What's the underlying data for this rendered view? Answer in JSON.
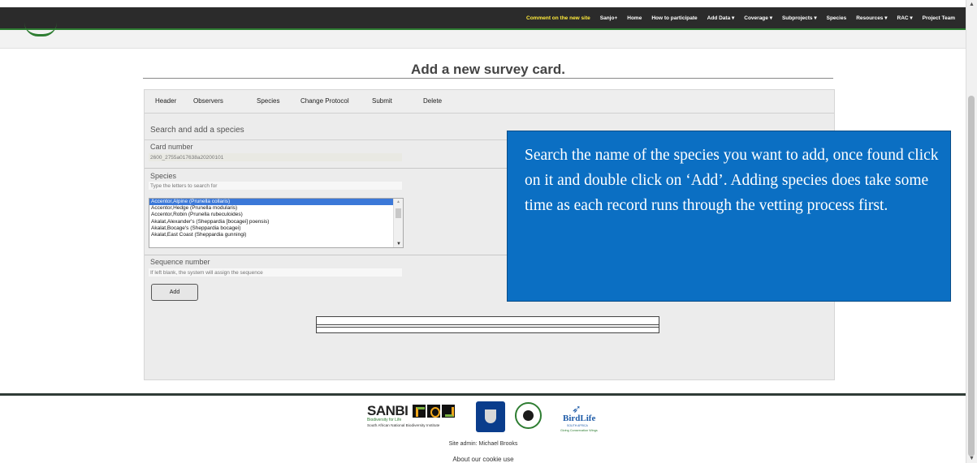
{
  "nav": {
    "items": [
      {
        "label": "Comment on the new site",
        "highlight": true
      },
      {
        "label": "Sanjo+"
      },
      {
        "label": "Home"
      },
      {
        "label": "How to participate"
      },
      {
        "label": "Add Data ▾"
      },
      {
        "label": "Coverage ▾"
      },
      {
        "label": "Subprojects ▾"
      },
      {
        "label": "Species"
      },
      {
        "label": "Resources ▾"
      },
      {
        "label": "RAC ▾"
      },
      {
        "label": "Project Team"
      }
    ],
    "highlight_color": "#ffeb3b"
  },
  "page": {
    "title": "Add a new survey card."
  },
  "tabs": [
    "Header",
    "Observers",
    "Species",
    "Change Protocol",
    "Submit",
    "Delete"
  ],
  "form": {
    "section_title": "Search and add a species",
    "card_number_label": "Card number",
    "card_number_value": "2600_2755a017638a20200101",
    "species_label": "Species",
    "species_placeholder": "Type the letters to search for",
    "species_options": [
      {
        "label": "Accentor,Alpine (Prunella collaris)",
        "selected": true
      },
      {
        "label": "Accentor,Hedge (Prunella modularis)"
      },
      {
        "label": "Accentor,Robin (Prunella rubeculoides)"
      },
      {
        "label": "Akalat,Alexander's (Sheppardia [bocagei] poensis)"
      },
      {
        "label": "Akalat,Bocage's (Sheppardia bocagei)"
      },
      {
        "label": "Akalat,East Coast (Sheppardia gunningi)"
      }
    ],
    "sequence_label": "Sequence number",
    "sequence_placeholder": "If left blank, the system will assign the sequence",
    "add_label": "Add"
  },
  "callout": {
    "text": "Search the name of the species you want to add, once found click on it and double click on ‘Add’. Adding species does take some time as each record runs through the vetting process first.",
    "background": "#0b6fc3"
  },
  "footer": {
    "sanbi_name": "SANBI",
    "sanbi_tagline": "Biodiversity for Life",
    "sanbi_full": "South African National Biodiversity Institute",
    "birdlife_name": "BirdLife",
    "birdlife_sub": "SOUTH AFRICA",
    "birdlife_tag": "Giving Conservation Wings",
    "admin": "Site admin: Michael Brooks",
    "cookie": "About our cookie use"
  }
}
